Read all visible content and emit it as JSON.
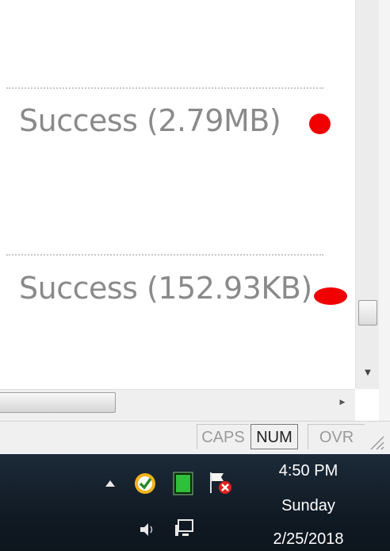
{
  "rows": [
    {
      "status": "Success (2.79MB)"
    },
    {
      "status": "Success (152.93KB)"
    }
  ],
  "statusbar": {
    "caps": "CAPS",
    "num": "NUM",
    "ovr": "OVR"
  },
  "taskbar": {
    "time": "4:50 PM",
    "day": "Sunday",
    "date": "2/25/2018"
  },
  "colors": {
    "status_text": "#8a8a8a",
    "indicator": "#f00000",
    "taskbar": "#16222e"
  }
}
